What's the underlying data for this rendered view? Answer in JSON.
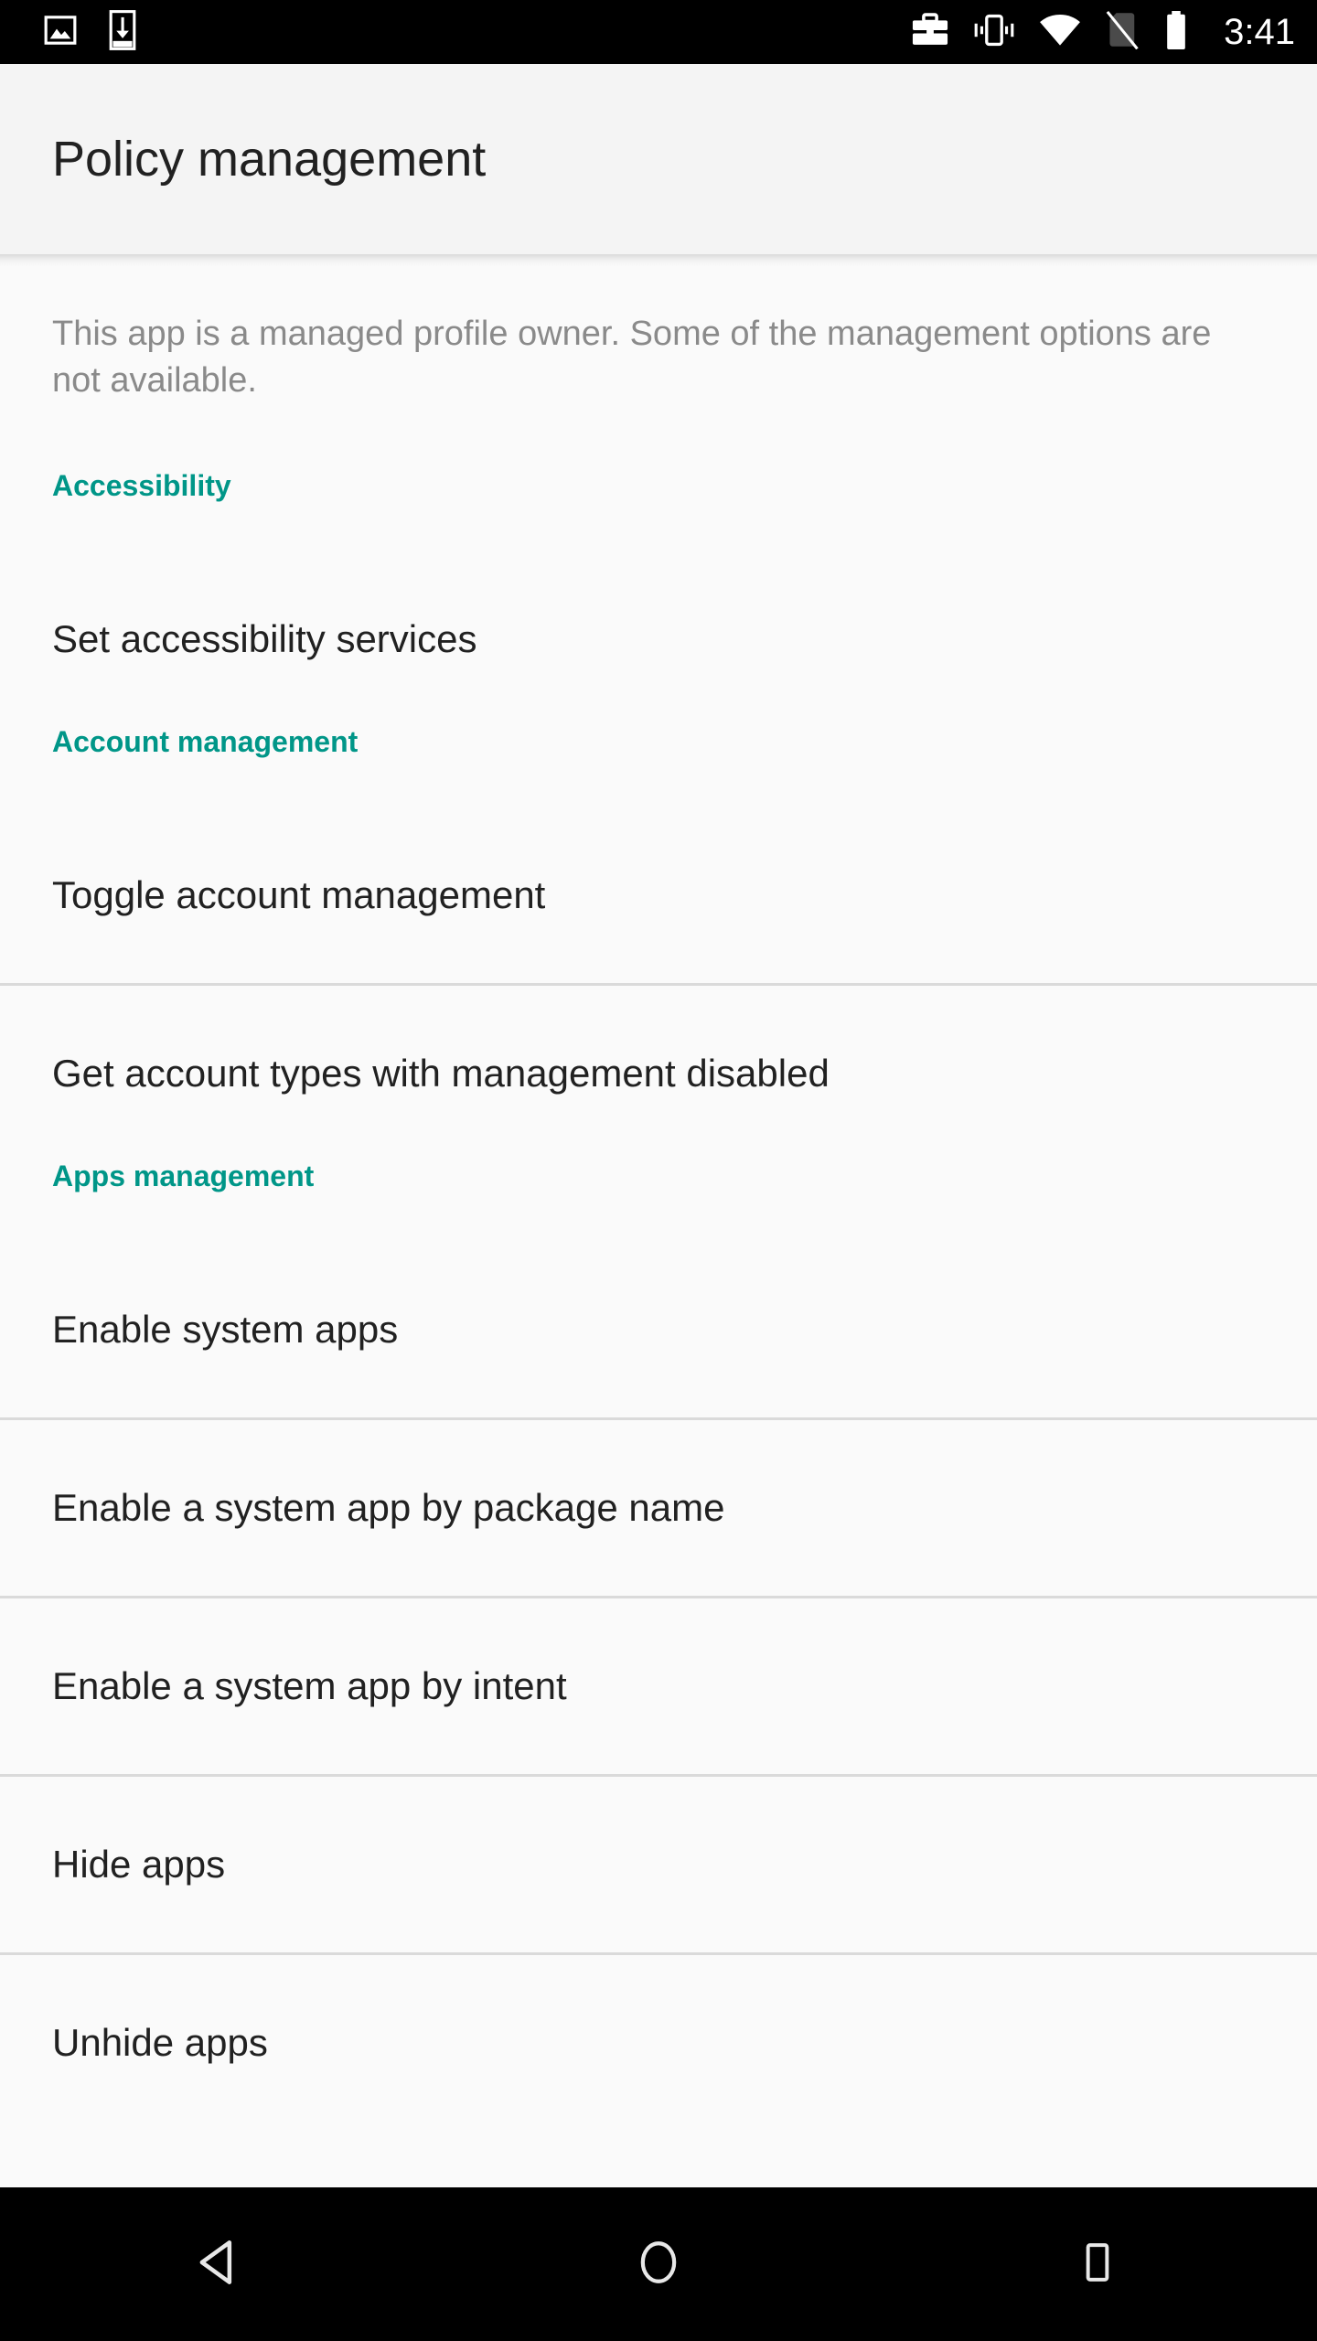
{
  "status_bar": {
    "left_icons": [
      "image-icon",
      "download-icon"
    ],
    "right_icons": [
      "work-briefcase-icon",
      "vibrate-icon",
      "wifi-icon",
      "no-sim-icon",
      "battery-icon"
    ],
    "time": "3:41"
  },
  "toolbar": {
    "title": "Policy management"
  },
  "content": {
    "description": "This app is a managed profile owner. Some of the management options are not available.",
    "sections": [
      {
        "header": "Accessibility",
        "items": [
          {
            "label": "Set accessibility services"
          }
        ]
      },
      {
        "header": "Account management",
        "items": [
          {
            "label": "Toggle account management"
          },
          {
            "label": "Get account types with management disabled"
          }
        ]
      },
      {
        "header": "Apps management",
        "items": [
          {
            "label": "Enable system apps"
          },
          {
            "label": "Enable a system app by package name"
          },
          {
            "label": "Enable a system app by intent"
          },
          {
            "label": "Hide apps"
          },
          {
            "label": "Unhide apps"
          }
        ]
      }
    ]
  },
  "nav_bar": {
    "back": "back-icon",
    "home": "home-icon",
    "recents": "recents-icon"
  },
  "colors": {
    "accent_teal": "#009688",
    "background": "#fafafa",
    "toolbar_background": "#f4f4f4",
    "primary_text": "#212121",
    "secondary_text": "#8a8a8a",
    "divider": "#dadada",
    "system_bar": "#000000"
  }
}
